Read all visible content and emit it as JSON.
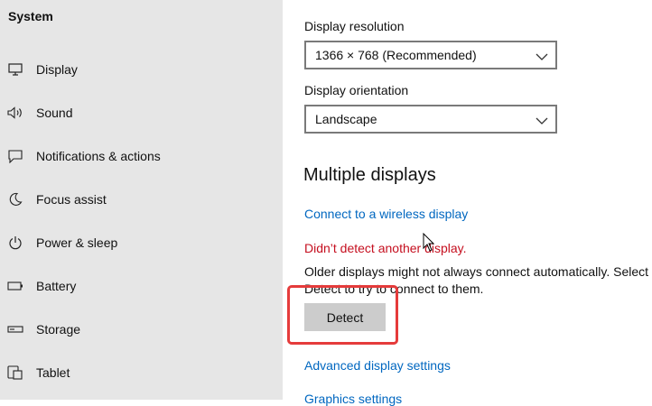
{
  "sidebar": {
    "title": "System",
    "items": [
      {
        "label": "Display",
        "icon": "monitor-icon"
      },
      {
        "label": "Sound",
        "icon": "speaker-icon"
      },
      {
        "label": "Notifications & actions",
        "icon": "notification-icon"
      },
      {
        "label": "Focus assist",
        "icon": "moon-icon"
      },
      {
        "label": "Power & sleep",
        "icon": "power-icon"
      },
      {
        "label": "Battery",
        "icon": "battery-icon"
      },
      {
        "label": "Storage",
        "icon": "storage-icon"
      },
      {
        "label": "Tablet",
        "icon": "tablet-icon"
      }
    ]
  },
  "main": {
    "resolution": {
      "label": "Display resolution",
      "value": "1366 × 768 (Recommended)"
    },
    "orientation": {
      "label": "Display orientation",
      "value": "Landscape"
    },
    "multiple_displays": {
      "heading": "Multiple displays",
      "wireless_link": "Connect to a wireless display",
      "error_text": "Didn’t detect another display.",
      "description": "Older displays might not always connect automatically. Select Detect to try to connect to them.",
      "detect_button": "Detect"
    },
    "advanced_link": "Advanced display settings",
    "graphics_link": "Graphics settings"
  },
  "colors": {
    "sidebar_bg": "#e6e6e6",
    "link": "#0067c0",
    "error": "#c50f1f",
    "highlight": "#e53b3b",
    "button_bg": "#cccccc"
  }
}
